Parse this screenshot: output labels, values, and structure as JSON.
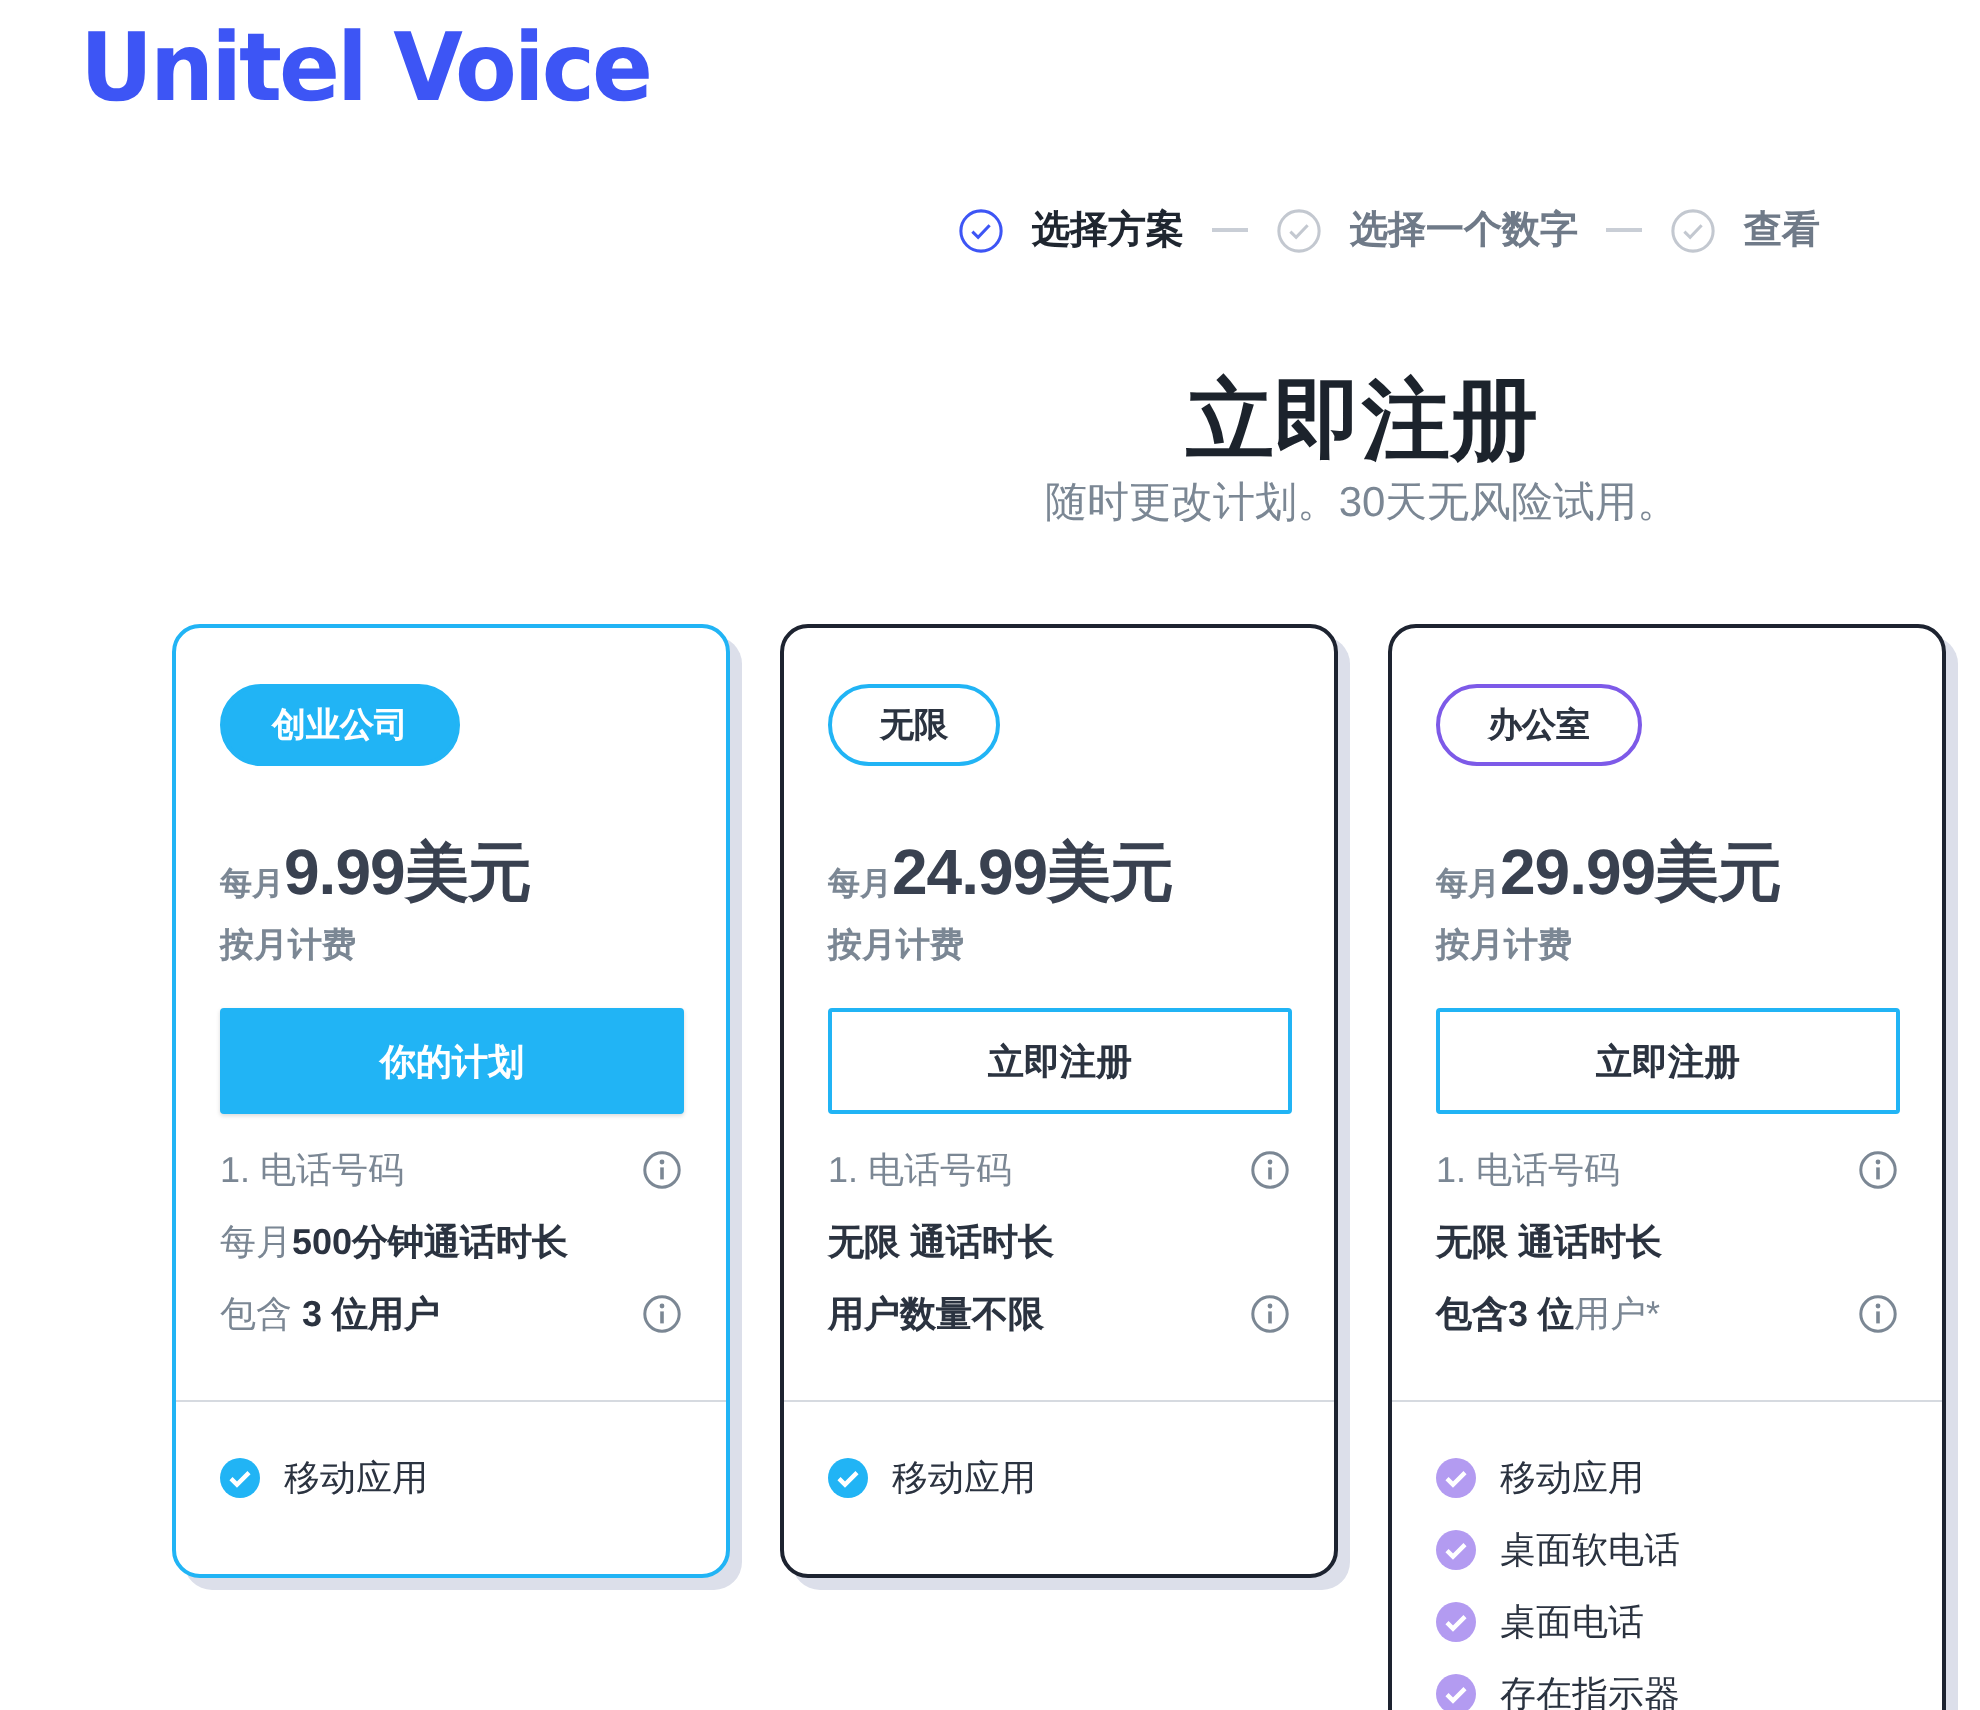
{
  "logo": {
    "text": "Unitel Voice"
  },
  "steps": [
    {
      "label": "选择方案",
      "selected": true
    },
    {
      "label": "选择一个数字",
      "selected": false
    },
    {
      "label": "查看",
      "selected": false
    }
  ],
  "heading": {
    "title": "立即注册",
    "subtitle": "随时更改计划。30天无风险试用。"
  },
  "plans": [
    {
      "selected": true,
      "badge": {
        "label": "创业公司",
        "kind": "filled",
        "color": "#21b4f5"
      },
      "price_prefix": "每月",
      "price": "9.99美元",
      "billing": "按月计费",
      "button": {
        "label": "你的计划",
        "kind": "filled"
      },
      "features": [
        {
          "text": "1. 电话号码",
          "strong": false,
          "info": true
        },
        {
          "text": "每月**500分钟通话时长**",
          "strong": false,
          "info": false
        },
        {
          "text": "包含 **3 位用户**",
          "strong": false,
          "info": true
        }
      ],
      "apps": [
        {
          "label": "移动应用",
          "color": "#21b4f5"
        }
      ]
    },
    {
      "selected": false,
      "badge": {
        "label": "无限",
        "kind": "outline",
        "color": "#21b4f5"
      },
      "price_prefix": "每月",
      "price": "24.99美元",
      "billing": "按月计费",
      "button": {
        "label": "立即注册",
        "kind": "outline"
      },
      "features": [
        {
          "text": "1. 电话号码",
          "strong": false,
          "info": true
        },
        {
          "text": "无限 通话时长",
          "strong": true,
          "info": false
        },
        {
          "text": "用户数量不限",
          "strong": true,
          "info": true
        }
      ],
      "apps": [
        {
          "label": "移动应用",
          "color": "#21b4f5"
        }
      ]
    },
    {
      "selected": false,
      "badge": {
        "label": "办公室",
        "kind": "outline",
        "color": "#7d5ae8"
      },
      "price_prefix": "每月",
      "price": "29.99美元",
      "billing": "按月计费",
      "button": {
        "label": "立即注册",
        "kind": "outline"
      },
      "features": [
        {
          "text": "1. 电话号码",
          "strong": false,
          "info": true
        },
        {
          "text": "无限 通话时长",
          "strong": true,
          "info": false
        },
        {
          "text": "**包含3 位**用户*",
          "strong": false,
          "info": true
        }
      ],
      "apps": [
        {
          "label": "移动应用",
          "color": "#b39bf1"
        },
        {
          "label": "桌面软电话",
          "color": "#b39bf1"
        },
        {
          "label": "桌面电话",
          "color": "#b39bf1"
        },
        {
          "label": "存在指示器",
          "color": "#b39bf1"
        }
      ]
    }
  ]
}
